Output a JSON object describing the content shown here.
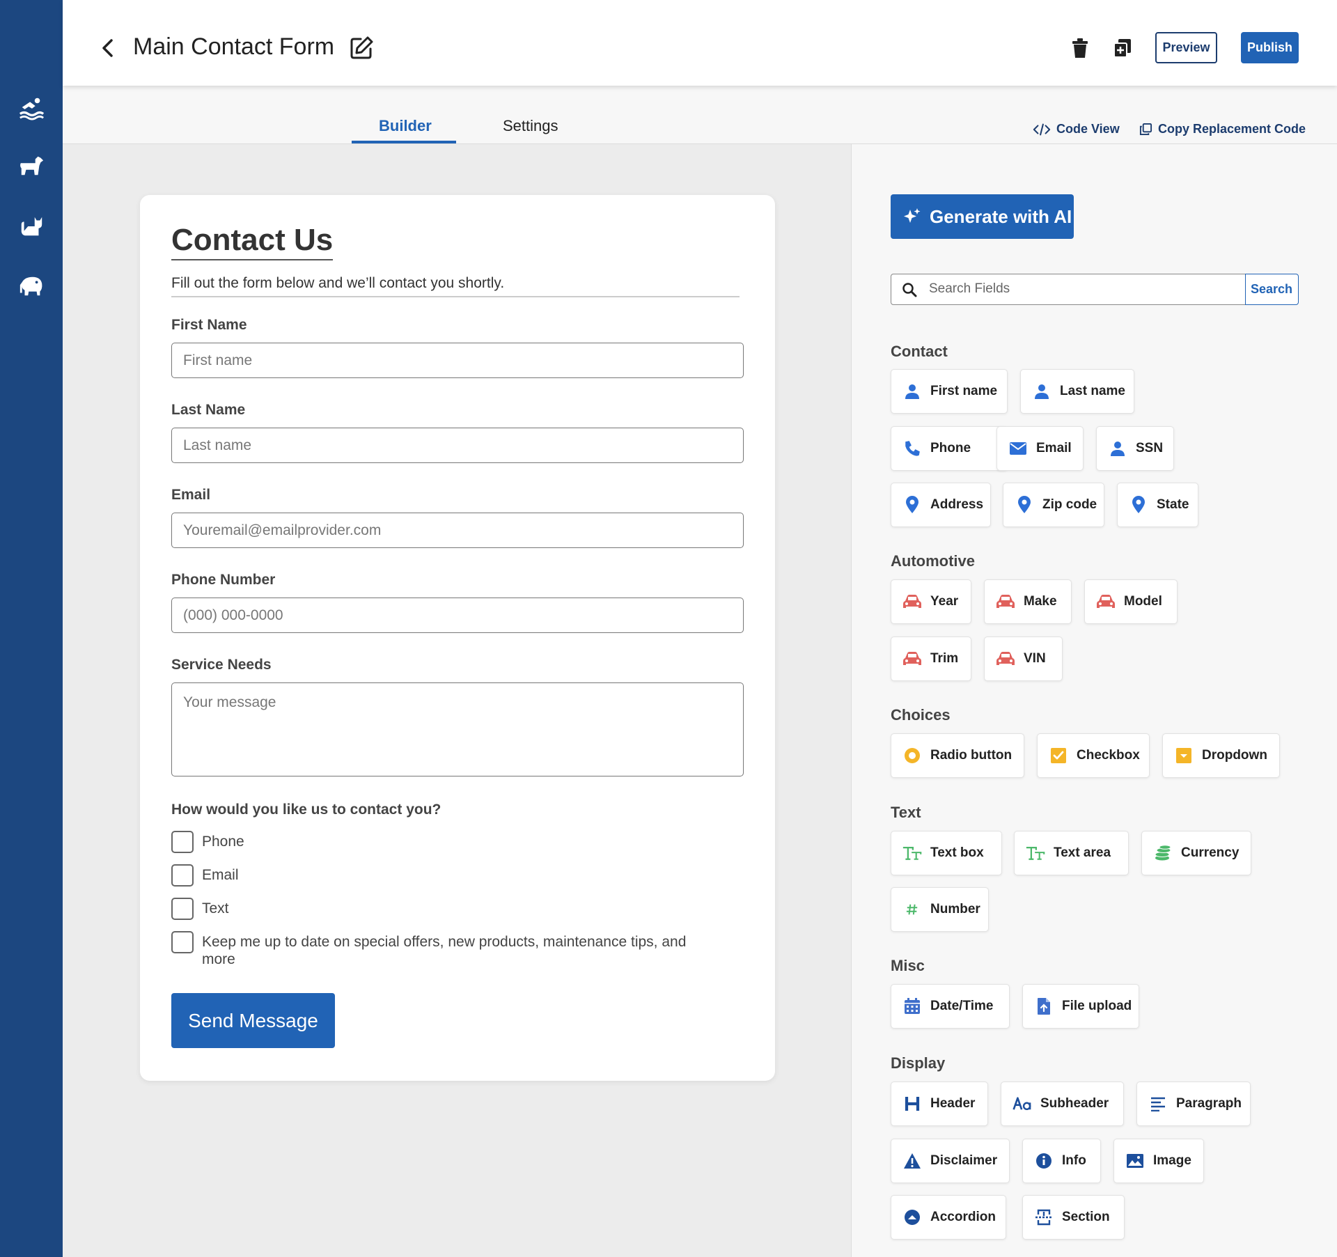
{
  "header": {
    "title": "Main Contact Form",
    "preview_label": "Preview",
    "publish_label": "Publish"
  },
  "tabs": {
    "builder": "Builder",
    "settings": "Settings",
    "code_view": "Code View",
    "copy_code": "Copy Replacement Code"
  },
  "form": {
    "title": "Contact Us",
    "subtitle": "Fill out the form below and we’ll contact you shortly.",
    "fields": [
      {
        "label": "First Name",
        "placeholder": "First name"
      },
      {
        "label": "Last Name",
        "placeholder": "Last name"
      },
      {
        "label": "Email",
        "placeholder": "Youremail@emailprovider.com"
      },
      {
        "label": "Phone Number",
        "placeholder": "(000) 000-0000"
      }
    ],
    "textarea": {
      "label": "Service Needs",
      "placeholder": "Your message"
    },
    "contact_question": "How would you like us to contact you?",
    "checkboxes": [
      "Phone",
      "Email",
      "Text",
      "Keep me up to date on special offers, new products, maintenance tips, and more"
    ],
    "submit_label": "Send Message"
  },
  "panel": {
    "ai_label": "Generate with AI",
    "search_placeholder": "Search Fields",
    "search_button": "Search",
    "categories": [
      {
        "title": "Contact",
        "items": [
          "First name",
          "Last name",
          "Phone",
          "Email",
          "SSN",
          "Address",
          "Zip code",
          "State"
        ]
      },
      {
        "title": "Automotive",
        "items": [
          "Year",
          "Make",
          "Model",
          "Trim",
          "VIN"
        ]
      },
      {
        "title": "Choices",
        "items": [
          "Radio button",
          "Checkbox",
          "Dropdown"
        ]
      },
      {
        "title": "Text",
        "items": [
          "Text box",
          "Text area",
          "Currency",
          "Number"
        ]
      },
      {
        "title": "Misc",
        "items": [
          "Date/Time",
          "File upload"
        ]
      },
      {
        "title": "Display",
        "items": [
          "Header",
          "Subheader",
          "Paragraph",
          "Disclaimer",
          "Info",
          "Image",
          "Accordion",
          "Section"
        ]
      }
    ]
  },
  "icons": {
    "sidebar": [
      "swimmer-icon",
      "dog-icon",
      "cat-icon",
      "elephant-icon"
    ],
    "contact": [
      "user-icon",
      "user-icon",
      "phone-icon",
      "envelope-icon",
      "user-icon",
      "map-pin-icon",
      "map-pin-icon",
      "map-pin-icon"
    ],
    "automotive": [
      "car-icon",
      "car-icon",
      "car-icon",
      "car-icon",
      "car-icon"
    ],
    "choices": [
      "radio-icon",
      "checkbox-icon",
      "dropdown-icon"
    ],
    "text": [
      "text-box-icon",
      "text-area-icon",
      "coins-icon",
      "hash-icon"
    ],
    "misc": [
      "calendar-icon",
      "file-upload-icon"
    ],
    "display": [
      "header-h-icon",
      "subheader-aa-icon",
      "paragraph-lines-icon",
      "warning-icon",
      "info-icon",
      "image-icon",
      "accordion-icon",
      "section-icon"
    ]
  },
  "colors": {
    "sidebar": "#1c4780",
    "primary": "#2163b5",
    "contact_icon": "#2d6fd6",
    "automotive_icon": "#e0615c",
    "choices_icon": "#f4b528",
    "text_icon": "#4cb86a",
    "misc_icon": "#3f6fcb",
    "display_icon": "#1d4f9c"
  }
}
